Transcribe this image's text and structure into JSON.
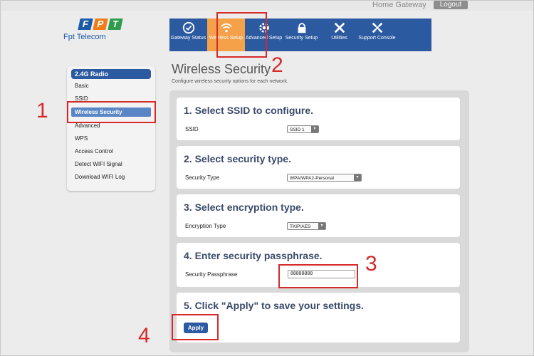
{
  "header": {
    "home_gateway": "Home Gateway",
    "logout": "Logout",
    "logo_sub": "Fpt Telecom",
    "logo_letters": [
      "F",
      "P",
      "T"
    ],
    "brand_colors": {
      "blue": "#1a5aa6",
      "orange": "#f07d1a",
      "green": "#2e9c4a"
    }
  },
  "nav": [
    {
      "label": "Gateway Status",
      "icon": "checkmark-circle-icon"
    },
    {
      "label": "Wireless Setup",
      "icon": "wifi-icon",
      "active": true
    },
    {
      "label": "Advanced Setup",
      "icon": "gear-icon"
    },
    {
      "label": "Security Setup",
      "icon": "lock-icon"
    },
    {
      "label": "Utilities",
      "icon": "tools-icon"
    },
    {
      "label": "Support Console",
      "icon": "support-icon"
    }
  ],
  "sidebar": {
    "header": "2.4G Radio",
    "items": [
      {
        "label": "Basic"
      },
      {
        "label": "SSID"
      },
      {
        "label": "Wireless Security",
        "active": true
      },
      {
        "label": "Advanced"
      },
      {
        "label": "WPS"
      },
      {
        "label": "Access Control"
      },
      {
        "label": "Detect WIFI Signal"
      },
      {
        "label": "Download WIFI Log"
      }
    ]
  },
  "main": {
    "title": "Wireless Security",
    "subtitle": "Configure wireless security options for each network.",
    "sections": [
      {
        "title": "1. Select SSID to configure.",
        "label": "SSID",
        "value": "SSID 1"
      },
      {
        "title": "2. Select security type.",
        "label": "Security Type",
        "value": "WPA/WPA2-Personal"
      },
      {
        "title": "3. Select encryption type.",
        "label": "Encryption Type",
        "value": "TKIP/AES"
      },
      {
        "title": "4. Enter security passphrase.",
        "label": "Security Passphrase",
        "value": "88888888"
      },
      {
        "title": "5. Click \"Apply\" to save your settings.",
        "button": "Apply"
      }
    ]
  },
  "annotations": {
    "labels": [
      "1",
      "2",
      "3",
      "4"
    ],
    "color": "#d62a2a"
  }
}
